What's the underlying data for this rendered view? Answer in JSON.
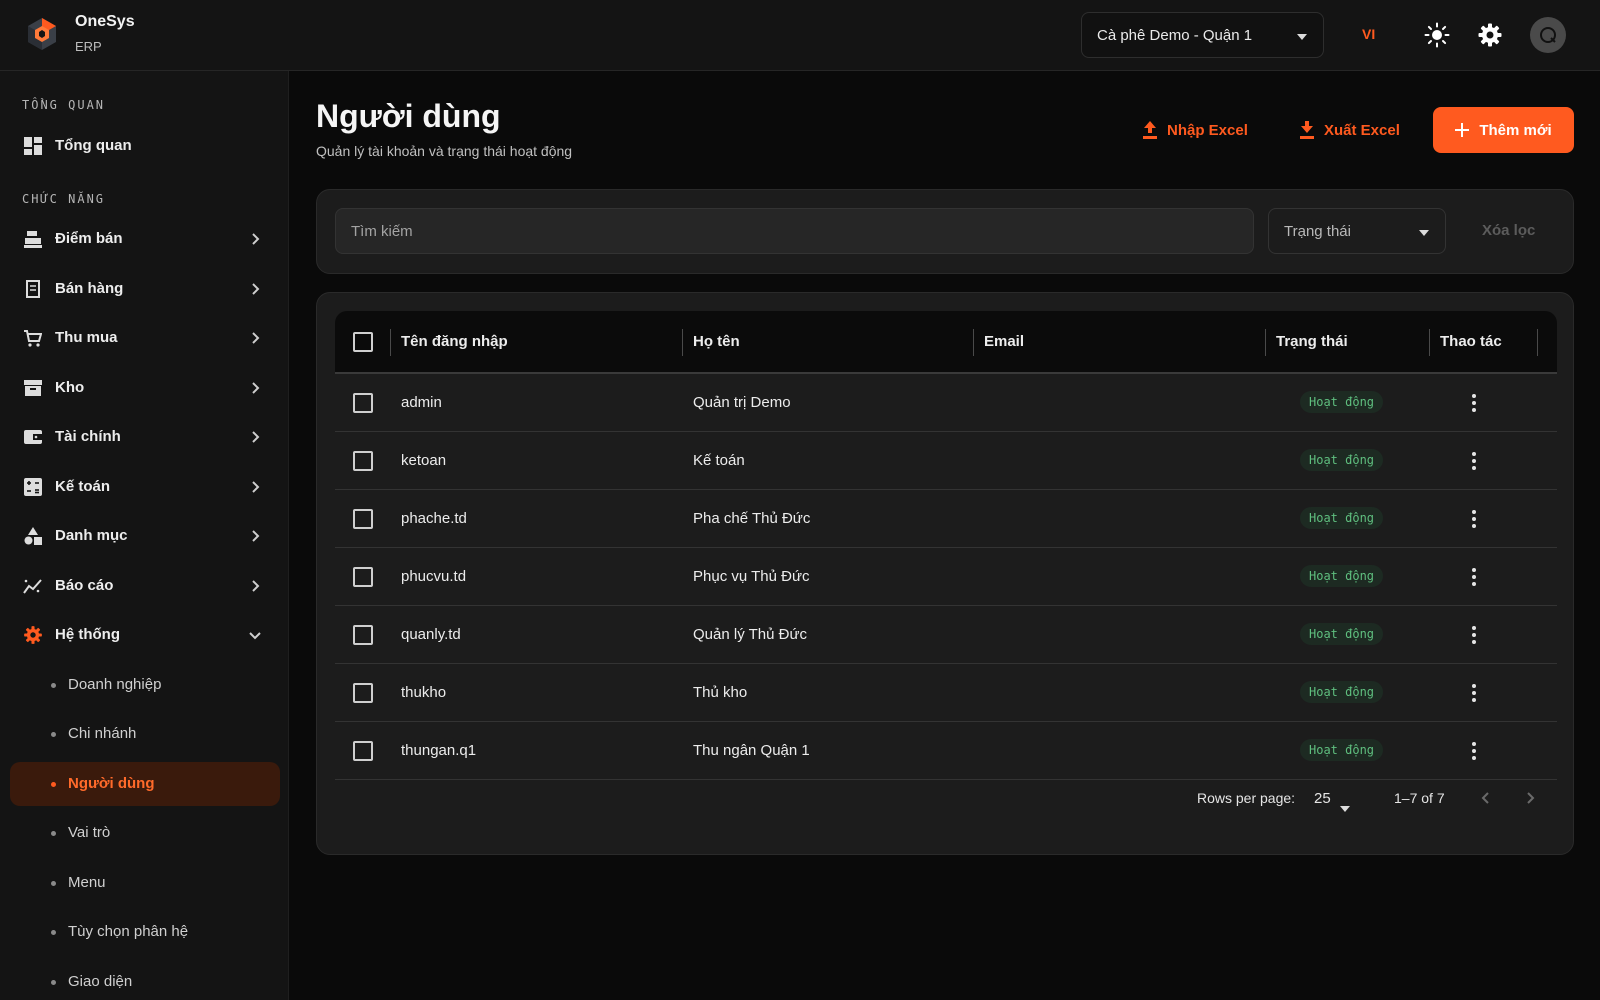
{
  "app": {
    "name": "OneSys",
    "subtitle": "ERP"
  },
  "topbar": {
    "branch": "Cà phê Demo - Quận 1",
    "language": "VI",
    "icons": [
      "sun-icon",
      "gear-icon",
      "avatar-q"
    ]
  },
  "sidebar": {
    "sections": [
      "TỔNG QUAN",
      "CHỨC NĂNG"
    ],
    "overview": "Tổng quan",
    "items": [
      "Điểm bán",
      "Bán hàng",
      "Thu mua",
      "Kho",
      "Tài chính",
      "Kế toán",
      "Danh mục",
      "Báo cáo",
      "Hệ thống"
    ],
    "system_sub": [
      "Doanh nghiệp",
      "Chi nhánh",
      "Người dùng",
      "Vai trò",
      "Menu",
      "Tùy chọn phân hệ",
      "Giao diện"
    ]
  },
  "page": {
    "title": "Người dùng",
    "subtitle": "Quản lý tài khoản và trạng thái hoạt động",
    "import_label": "Nhập Excel",
    "export_label": "Xuất Excel",
    "add_label": "Thêm mới"
  },
  "filters": {
    "search_placeholder": "Tìm kiếm",
    "status_label": "Trạng thái",
    "clear_label": "Xóa lọc"
  },
  "table": {
    "columns": [
      "Tên đăng nhập",
      "Họ tên",
      "Email",
      "Trạng thái",
      "Thao tác"
    ],
    "rows": [
      {
        "username": "admin",
        "fullname": "Quản trị Demo",
        "email": "",
        "status": "Hoạt động"
      },
      {
        "username": "ketoan",
        "fullname": "Kế toán",
        "email": "",
        "status": "Hoạt động"
      },
      {
        "username": "phache.td",
        "fullname": "Pha chế Thủ Đức",
        "email": "",
        "status": "Hoạt động"
      },
      {
        "username": "phucvu.td",
        "fullname": "Phục vụ Thủ Đức",
        "email": "",
        "status": "Hoạt động"
      },
      {
        "username": "quanly.td",
        "fullname": "Quản lý Thủ Đức",
        "email": "",
        "status": "Hoạt động"
      },
      {
        "username": "thukho",
        "fullname": "Thủ kho",
        "email": "",
        "status": "Hoạt động"
      },
      {
        "username": "thungan.q1",
        "fullname": "Thu ngân Quận 1",
        "email": "",
        "status": "Hoạt động"
      }
    ]
  },
  "pagination": {
    "rows_label": "Rows per page:",
    "rows_value": "25",
    "range": "1–7 of 7"
  },
  "colors": {
    "accent": "#ff5a1f",
    "active_badge": "#5fbf7f",
    "bg": "#0a0a0a",
    "panel": "#1c1c1c"
  }
}
